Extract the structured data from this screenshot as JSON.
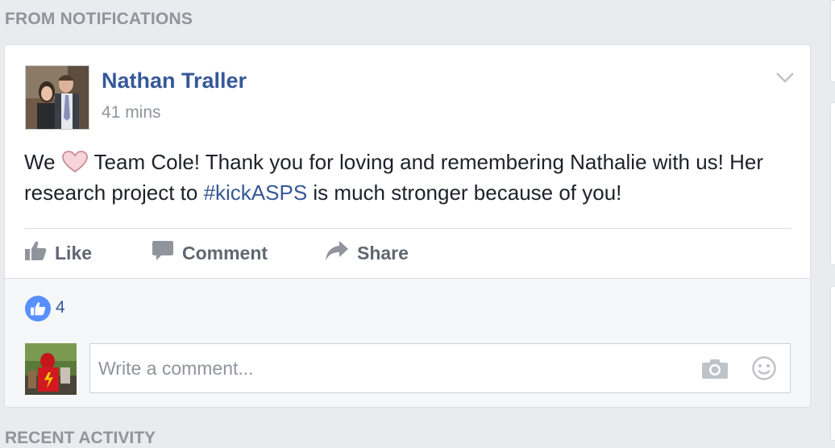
{
  "sections": {
    "notifications_header": "FROM NOTIFICATIONS",
    "recent_activity_header": "RECENT ACTIVITY"
  },
  "post": {
    "author": "Nathan Traller",
    "timestamp": "41 mins",
    "text_before_heart": "We",
    "text_after_heart": "Team Cole! Thank you for loving and remembering Nathalie with us! Her research project to",
    "hashtag": "#kickASPS",
    "text_after_hashtag": "is much stronger because of you!",
    "actions": {
      "like": "Like",
      "comment": "Comment",
      "share": "Share"
    },
    "like_count": "4"
  },
  "comment_box": {
    "placeholder": "Write a comment..."
  },
  "colors": {
    "link_blue": "#365899",
    "like_blue": "#5890ff",
    "muted_gray": "#90949c",
    "background": "#e9ebee"
  },
  "icons": {
    "heart": "heart-icon",
    "chevron": "chevron-down-icon",
    "like": "thumbs-up-icon",
    "comment": "speech-bubble-icon",
    "share": "share-arrow-icon",
    "camera": "camera-icon",
    "smiley": "smiley-icon"
  }
}
